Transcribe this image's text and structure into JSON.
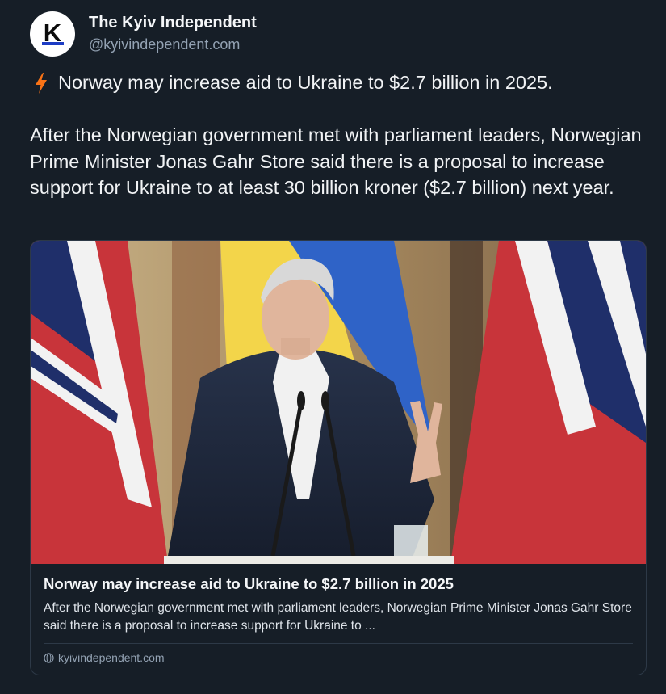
{
  "author": {
    "avatar_letter": "K",
    "display_name": "The Kyiv Independent",
    "handle": "@kyivindependent.com"
  },
  "post": {
    "headline_icon": "lightning-bolt-icon",
    "headline": "Norway may increase aid to Ukraine to $2.7 billion in 2025.",
    "body": "After the Norwegian government met with parliament leaders, Norwegian Prime Minister Jonas Gahr Store said there is a proposal to increase support for Ukraine to at least 30 billion kroner ($2.7 billion) next year."
  },
  "link_card": {
    "image_alt": "Norwegian Prime Minister at a podium with microphones, flags of Norway and Ukraine behind",
    "title": "Norway may increase aid to Ukraine to $2.7 billion in 2025",
    "description": "After the Norwegian government met with parliament leaders, Norwegian Prime Minister Jonas Gahr Store said there is a proposal to increase support for Ukraine to ...",
    "domain_icon": "globe-icon",
    "domain": "kyivindependent.com"
  },
  "colors": {
    "background": "#161e27",
    "text": "#f1f3f5",
    "muted": "#93a2b3",
    "bolt": "#f97316",
    "logo_bar": "#1d3cc4"
  }
}
